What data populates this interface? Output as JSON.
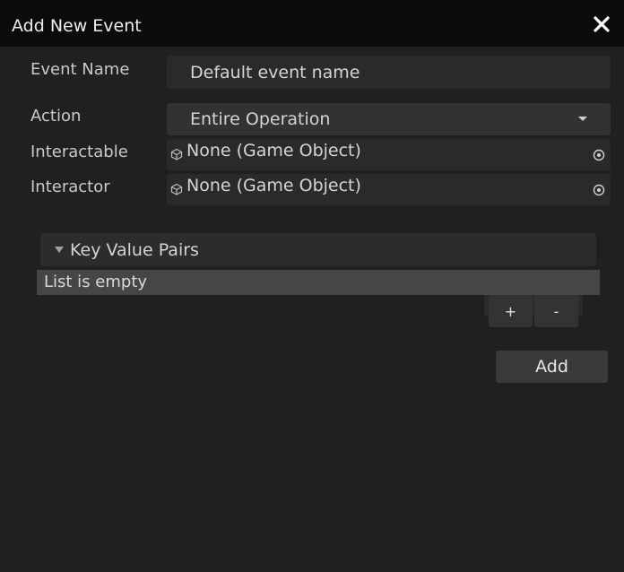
{
  "window": {
    "title": "Add New Event"
  },
  "form": {
    "event_name": {
      "label": "Event Name",
      "value": "Default event name"
    },
    "action": {
      "label": "Action",
      "value": "Entire Operation"
    },
    "interactable": {
      "label": "Interactable",
      "value": "None (Game Object)"
    },
    "interactor": {
      "label": "Interactor",
      "value": "None (Game Object)"
    }
  },
  "key_value_pairs": {
    "title": "Key Value Pairs",
    "empty_text": "List is empty",
    "add_label": "+",
    "remove_label": "-"
  },
  "add_button": {
    "label": "Add"
  },
  "icons": {
    "close": "close-icon",
    "dropdown": "caret-down-icon",
    "object": "cube-icon",
    "picker": "object-picker-icon",
    "foldout": "foldout-arrow-icon"
  }
}
